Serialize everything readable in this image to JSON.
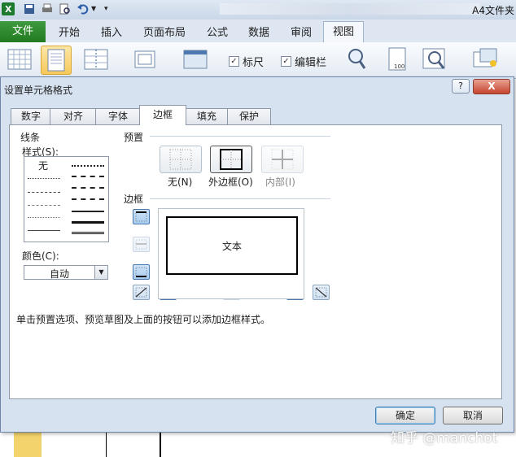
{
  "excel": {
    "window_title": "A4文件夹",
    "tabs": [
      "文件",
      "开始",
      "插入",
      "页面布局",
      "公式",
      "数据",
      "审阅",
      "视图"
    ],
    "active_tab": "视图",
    "ribbon": {
      "ruler_label": "标尺",
      "formula_bar_label": "编辑栏",
      "ruler_checked": true,
      "formula_bar_checked": true
    }
  },
  "dialog": {
    "title": "设置单元格格式",
    "help": "?",
    "close": "X",
    "tabs": [
      "数字",
      "对齐",
      "字体",
      "边框",
      "填充",
      "保护"
    ],
    "active_tab": "边框",
    "line": {
      "section": "线条",
      "style_label": "样式(S):",
      "none": "无",
      "color_label": "颜色(C):",
      "color_value": "自动"
    },
    "presets": {
      "section": "预置",
      "none": "无(N)",
      "outline": "外边框(O)",
      "inside": "内部(I)"
    },
    "border": {
      "section": "边框",
      "preview_text": "文本"
    },
    "hint": "单击预置选项、预览草图及上面的按钮可以添加边框样式。",
    "ok": "确定",
    "cancel": "取消"
  },
  "watermark": "知乎 @manchot",
  "colors": {
    "excel_green": "#217a21",
    "dialog_bg": "#d6e2f0",
    "close_red": "#c6432d"
  }
}
